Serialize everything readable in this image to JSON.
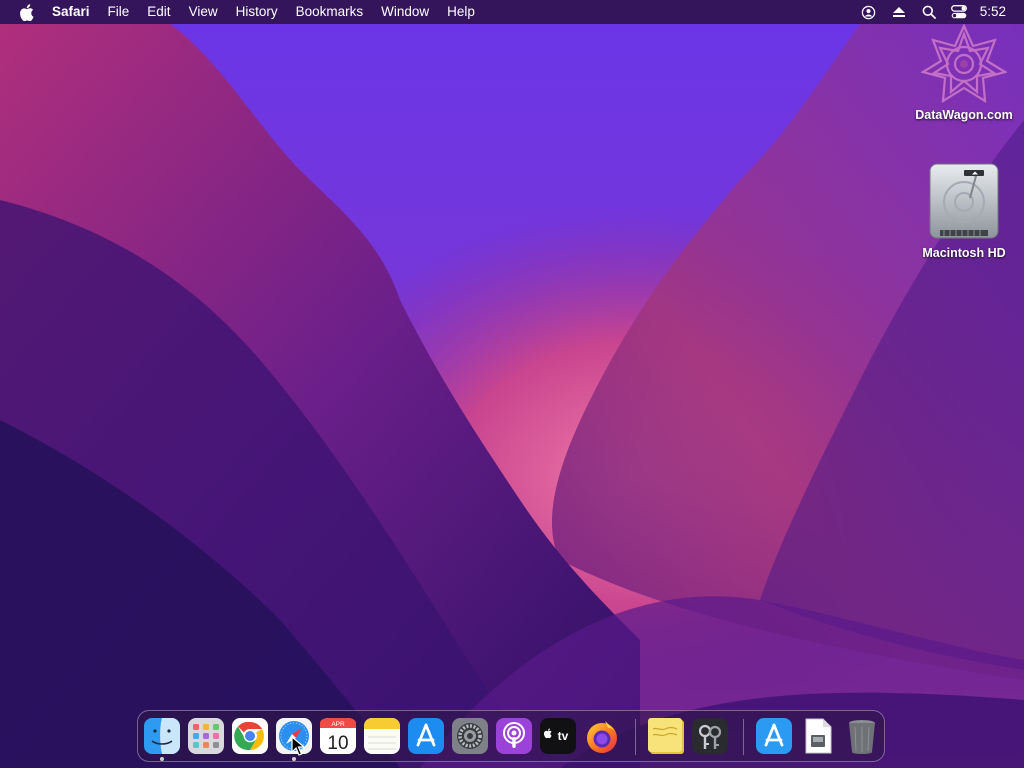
{
  "menubar": {
    "app_name": "Safari",
    "items": [
      "File",
      "Edit",
      "View",
      "History",
      "Bookmarks",
      "Window",
      "Help"
    ],
    "clock": "5:52"
  },
  "desktop": {
    "icons": [
      {
        "label": "DataWagon.com",
        "icon": "datawagon-logo-icon"
      },
      {
        "label": "Macintosh HD",
        "icon": "hard-drive-icon"
      }
    ]
  },
  "dock": {
    "calendar_month": "APR",
    "calendar_day": "10",
    "tv_label": "tv",
    "apps": [
      "Finder",
      "Launchpad",
      "Google Chrome",
      "Safari",
      "Calendar",
      "Notes",
      "App Store",
      "System Preferences",
      "Podcasts",
      "Apple TV",
      "Firefox",
      "Stickies",
      "Keychain Access",
      "App Store",
      "Preview",
      "Trash"
    ]
  }
}
